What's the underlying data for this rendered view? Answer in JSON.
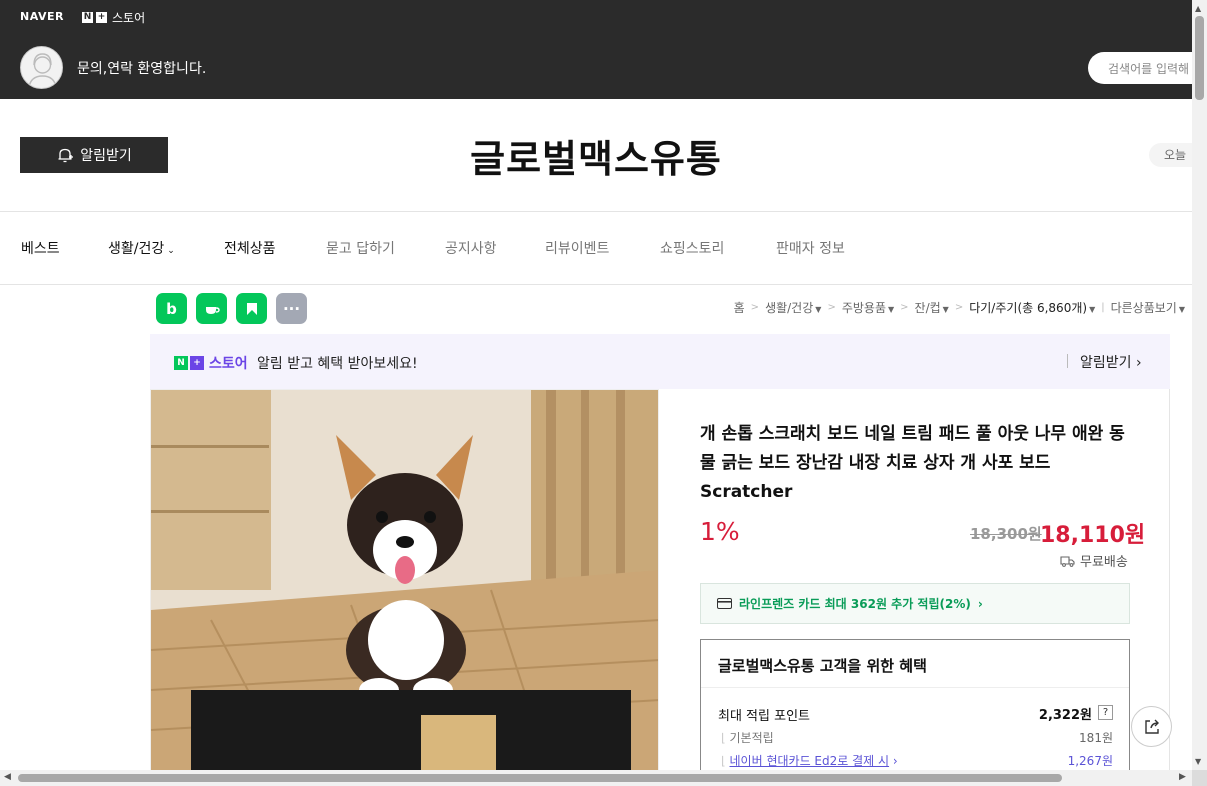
{
  "topbar": {
    "naver": "NAVER",
    "nplus_n": "N",
    "nplus_plus": "+",
    "nplus_store": "스토어",
    "welcome": "문의,연락 환영합니다.",
    "search_placeholder": "검색어를 입력해"
  },
  "header": {
    "alarm_button": "알림받기",
    "store_name": "글로벌맥스유통",
    "today_label": "오늘"
  },
  "nav": {
    "items": [
      "베스트",
      "생활/건강",
      "전체상품",
      "묻고 답하기",
      "공지사항",
      "리뷰이벤트",
      "쇼핑스토리",
      "판매자 정보"
    ]
  },
  "share_icons": {
    "blog_label": "b",
    "more_label": "···"
  },
  "breadcrumb": {
    "home": "홈",
    "cat1": "생활/건강",
    "cat2": "주방용품",
    "cat3": "잔/컵",
    "cat4": "다기/주기",
    "count": "(총 6,860개)",
    "other": "다른상품보기"
  },
  "banner": {
    "store_word": "스토어",
    "message": "알림 받고 혜택 받아보세요!",
    "alarm": "알림받기"
  },
  "product": {
    "title": "개 손톱 스크래치 보드 네일 트림 패드 풀 아웃 나무 애완 동물 긁는 보드 장난감 내장 치료 상자 개 사포 보드 Scratcher",
    "discount": "1%",
    "original_price": "18,300원",
    "price": "18,110원",
    "shipping": "무료배송",
    "card_promo": "라인프렌즈 카드 최대 362원 추가 적립(2%)"
  },
  "benefit": {
    "title": "글로벌맥스유통 고객을 위한 혜택",
    "max_points_label": "최대 적립 포인트",
    "max_points_value": "2,322원",
    "help": "?",
    "basic_label": "기본적립",
    "basic_value": "181원",
    "card_label": "네이버 현대카드 Ed2로 결제 시",
    "card_value": "1,267원"
  },
  "colors": {
    "topbar": "#2b2b2b",
    "discount_red": "#d71d3a",
    "naver_green": "#03c75a",
    "store_purple": "#6b45e6"
  }
}
